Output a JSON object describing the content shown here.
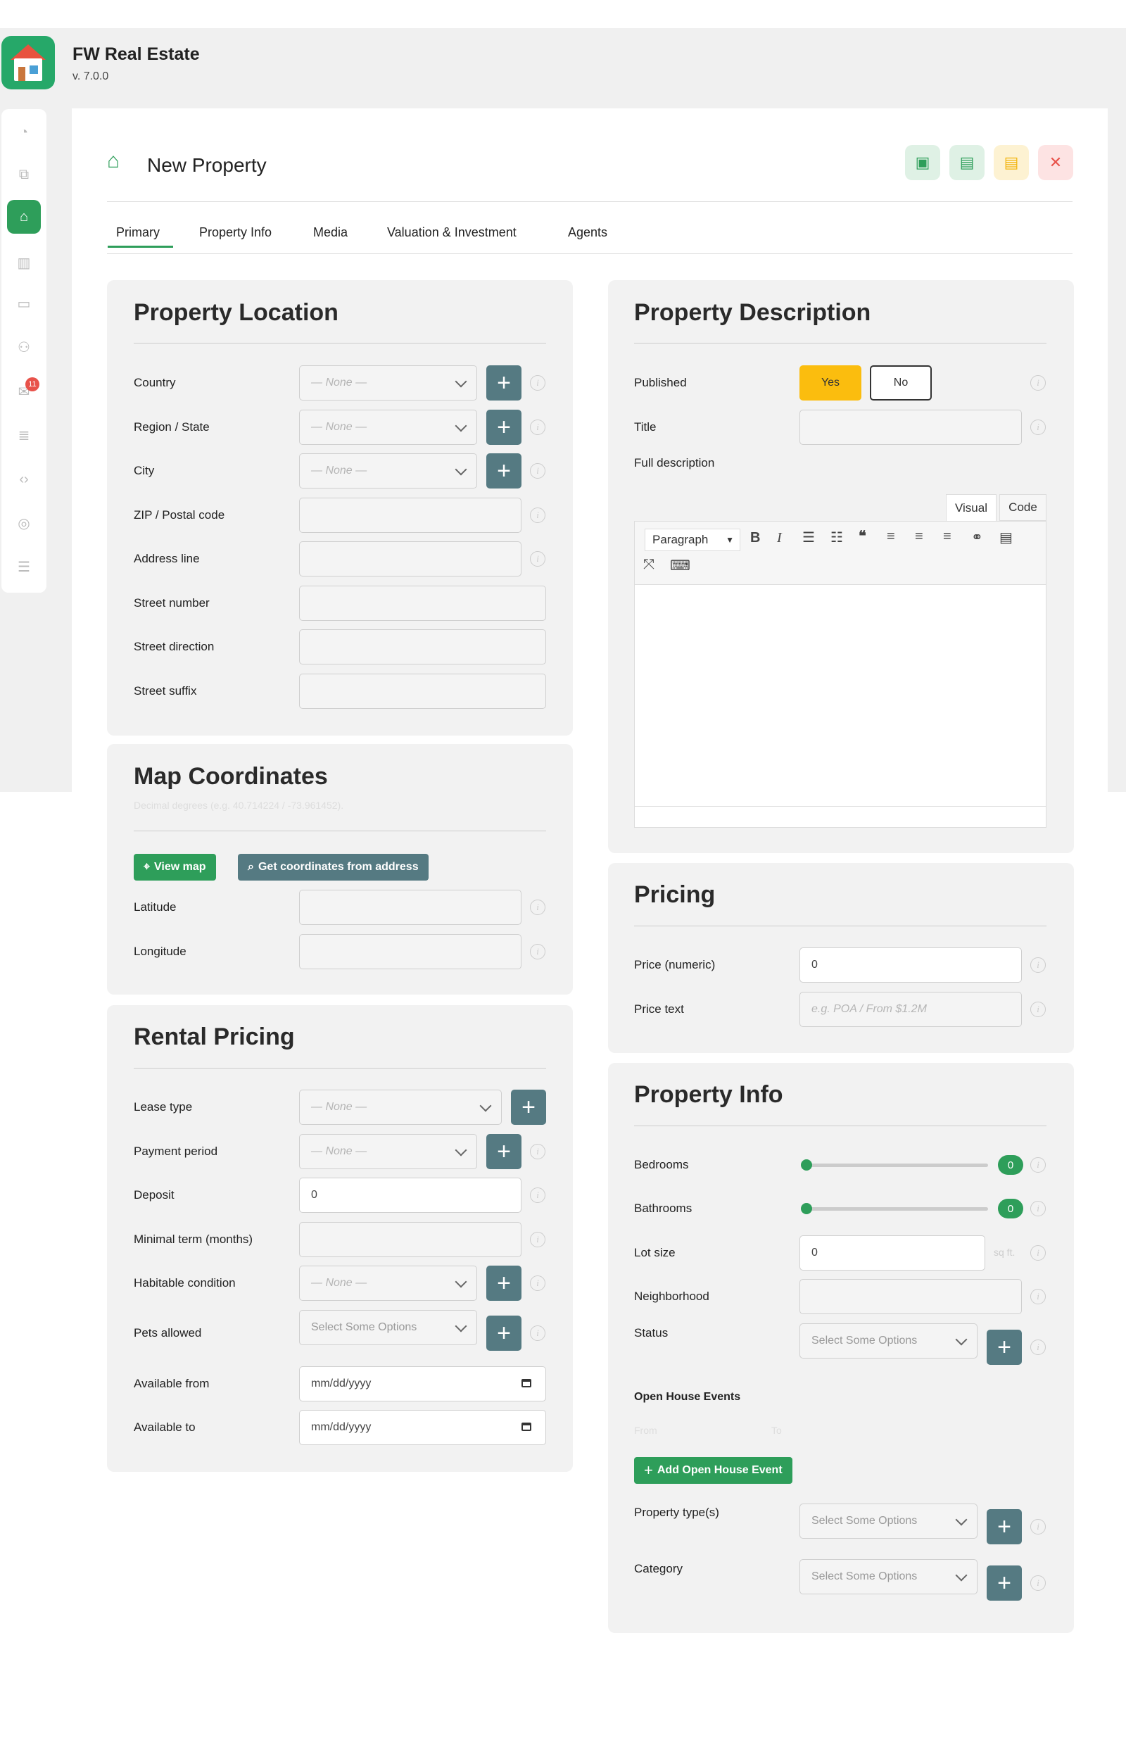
{
  "app": {
    "name": "FW Real Estate",
    "version": "v. 7.0.0"
  },
  "sidebar": {
    "badge_count": "11",
    "icons": [
      "dashboard-icon",
      "puzzle-icon",
      "home-icon",
      "library-icon",
      "card-icon",
      "users-icon",
      "mail-icon",
      "database-icon",
      "code-icon",
      "globe-icon",
      "settings-icon"
    ]
  },
  "page": {
    "title": "New Property"
  },
  "tabs": [
    "Primary",
    "Property Info",
    "Media",
    "Valuation & Investment",
    "Agents"
  ],
  "location": {
    "title": "Property Location",
    "fields": [
      "Country",
      "Region / State",
      "City",
      "ZIP / Postal code",
      "Address line",
      "Street number",
      "Street direction",
      "Street suffix"
    ],
    "none": "— None —"
  },
  "map": {
    "title": "Map Coordinates",
    "subtitle": "Decimal degrees (e.g. 40.714224 / -73.961452).",
    "view_map": "View map",
    "get_coords": "Get coordinates from address",
    "lat": "Latitude",
    "lng": "Longitude"
  },
  "rental": {
    "title": "Rental Pricing",
    "lease": "Lease type",
    "period": "Payment period",
    "deposit": "Deposit",
    "deposit_val": "0",
    "minterm": "Minimal term (months)",
    "habitable": "Habitable condition",
    "pets": "Pets allowed",
    "avail_from": "Available from",
    "avail_to": "Available to",
    "none": "— None —",
    "select": "Select Some Options",
    "date": "mm/dd/yyyy"
  },
  "description": {
    "title": "Property Description",
    "published": "Published",
    "yes": "Yes",
    "no": "No",
    "title_label": "Title",
    "full": "Full description",
    "visual": "Visual",
    "code": "Code",
    "paragraph": "Paragraph"
  },
  "pricing": {
    "title": "Pricing",
    "numeric": "Price (numeric)",
    "numeric_val": "0",
    "text": "Price text",
    "text_ph": "e.g. POA / From $1.2M"
  },
  "info": {
    "title": "Property Info",
    "bedrooms": "Bedrooms",
    "bathrooms": "Bathrooms",
    "bed_val": "0",
    "bath_val": "0",
    "lot": "Lot size",
    "lot_val": "0",
    "lot_unit": "sq ft.",
    "neighborhood": "Neighborhood",
    "status": "Status",
    "select": "Select Some Options",
    "open_house": "Open House Events",
    "from": "From",
    "to": "To",
    "add_event": "Add Open House Event",
    "types": "Property type(s)",
    "category": "Category"
  }
}
